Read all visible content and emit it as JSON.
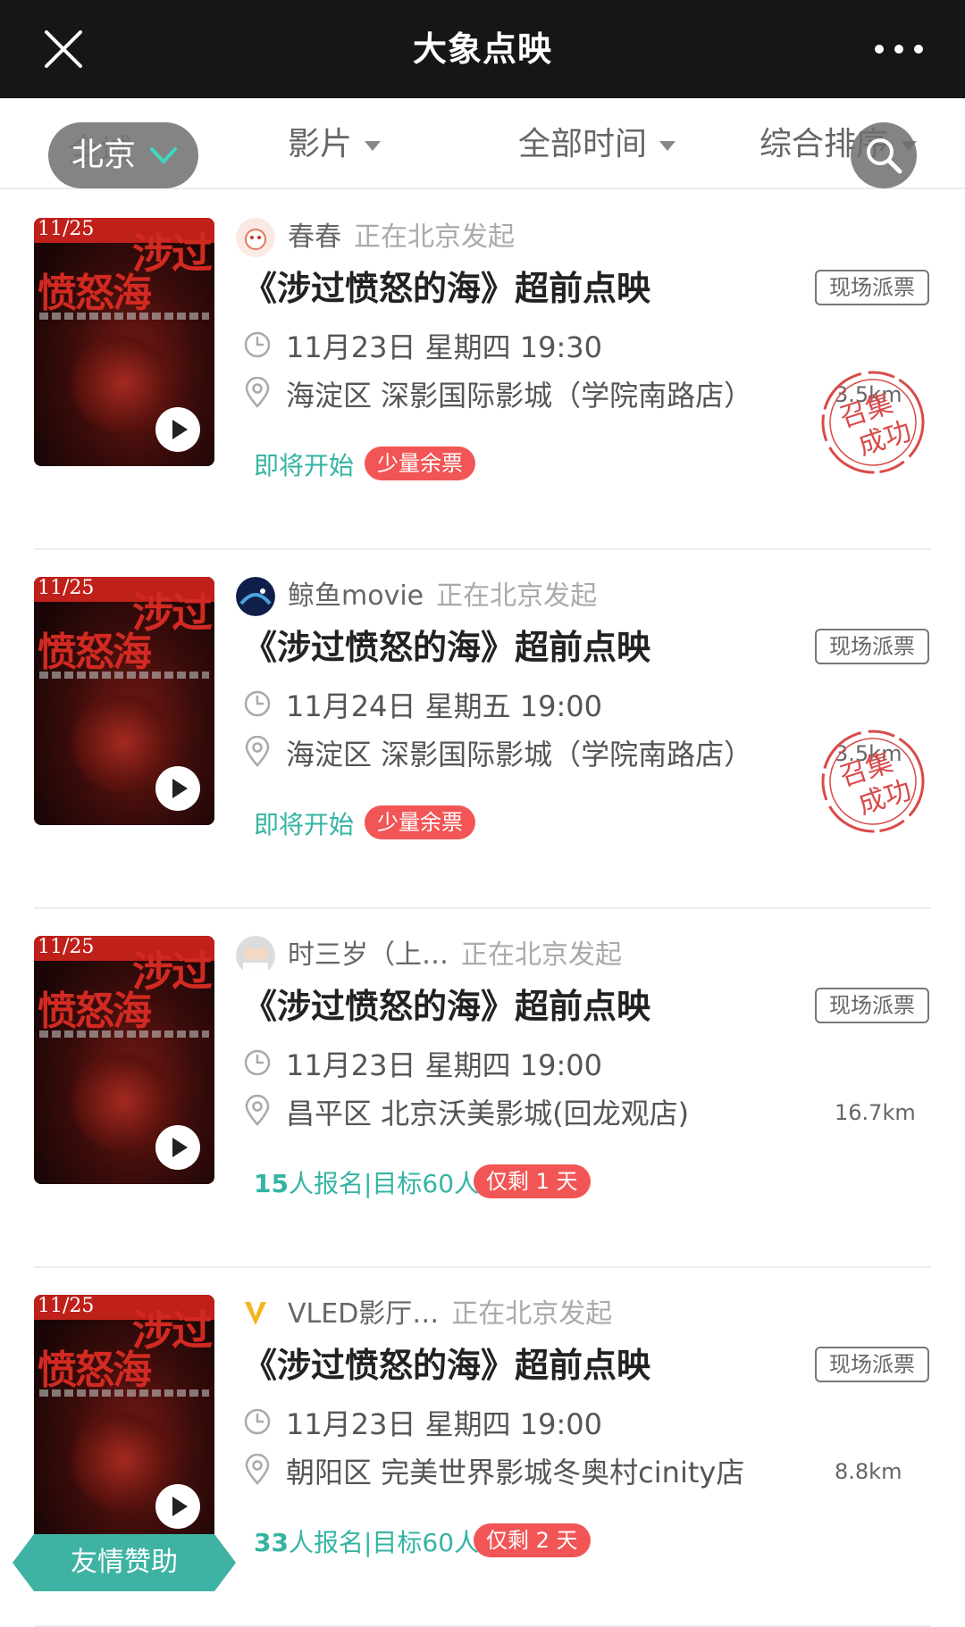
{
  "header": {
    "title": "大象点映",
    "close_icon": "close-icon",
    "more_icon": "more-icon"
  },
  "filters": {
    "city_behind": "全城",
    "city_selected": "北京",
    "film": "影片",
    "time": "全部时间",
    "sort": "综合排序"
  },
  "stamp_text": [
    "召集",
    "成功"
  ],
  "sponsor_label": "友情赞助",
  "colors": {
    "accent": "#35b4a3",
    "badge": "#f25555",
    "stamp": "#d94a4a",
    "topbar": "#161616"
  },
  "poster": {
    "date": "11/25",
    "title_a": "涉过",
    "title_b": "愤怒海"
  },
  "events": [
    {
      "organizer": "春春",
      "organizer_loc": "正在北京发起",
      "title": "《涉过愤怒的海》超前点映",
      "tag": "现场派票",
      "datetime": "11月23日  星期四  19:30",
      "venue": "海淀区  深影国际影城（学院南路店）",
      "distance": "3.5km",
      "status": "即将开始",
      "badge": "少量余票",
      "stamp": true
    },
    {
      "organizer": "鲸鱼movie",
      "organizer_loc": "正在北京发起",
      "title": "《涉过愤怒的海》超前点映",
      "tag": "现场派票",
      "datetime": "11月24日  星期五  19:00",
      "venue": "海淀区  深影国际影城（学院南路店）",
      "distance": "3.5km",
      "status": "即将开始",
      "badge": "少量余票",
      "stamp": true
    },
    {
      "organizer": "时三岁（上…",
      "organizer_loc": "正在北京发起",
      "title": "《涉过愤怒的海》超前点映",
      "tag": "现场派票",
      "datetime": "11月23日  星期四  19:00",
      "venue": "昌平区  北京沃美影城(回龙观店)",
      "distance": "16.7km",
      "status_count": "15",
      "status_rest": "人报名|目标60人",
      "badge": "仅剩 1 天",
      "stamp": false
    },
    {
      "organizer": "VLED影厅…",
      "organizer_loc": "正在北京发起",
      "title": "《涉过愤怒的海》超前点映",
      "tag": "现场派票",
      "datetime": "11月23日  星期四  19:00",
      "venue": "朝阳区  完美世界影城冬奥村cinity店",
      "distance": "8.8km",
      "status_count": "33",
      "status_rest": "人报名|目标60人",
      "badge": "仅剩 2 天",
      "stamp": false
    }
  ]
}
